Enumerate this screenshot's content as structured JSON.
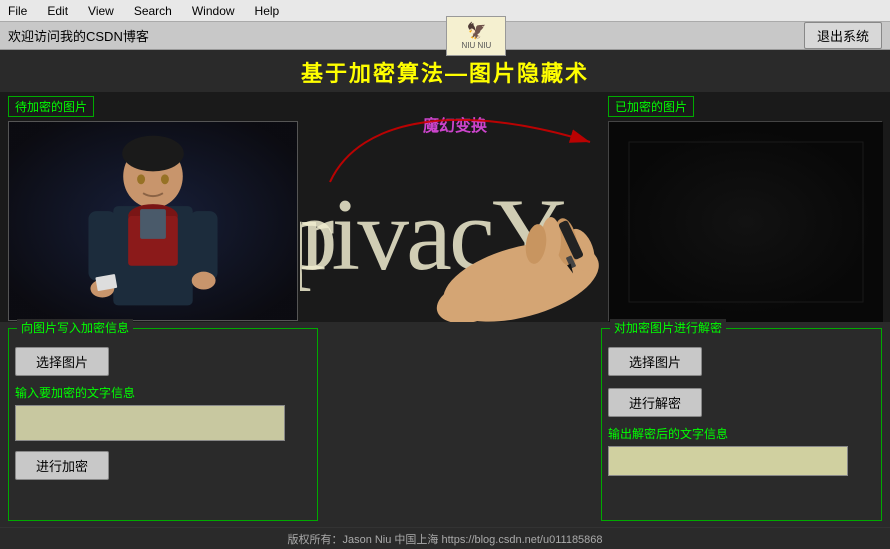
{
  "menubar": {
    "items": [
      "File",
      "Edit",
      "View",
      "Search",
      "Window",
      "Help"
    ]
  },
  "titlebar": {
    "welcome": "欢迎访问我的CSDN博客",
    "logo_text": "NIU NIU",
    "logout_label": "退出系统"
  },
  "main_title": "基于加密算法—图片隐藏术",
  "left_panel": {
    "label": "待加密的图片"
  },
  "center": {
    "magic_label": "魔幻变换",
    "privacy_text": "rivacY"
  },
  "right_panel": {
    "label": "已加密的图片"
  },
  "encrypt_section": {
    "title": "向图片写入加密信息",
    "select_btn": "选择图片",
    "input_label": "输入要加密的文字信息",
    "encrypt_btn": "进行加密"
  },
  "decrypt_section": {
    "title": "对加密图片进行解密",
    "select_btn": "选择图片",
    "decrypt_btn": "进行解密",
    "output_label": "输出解密后的文字信息"
  },
  "footer": {
    "text": "版权所有：Jason Niu  中国上海  https://blog.csdn.net/u011185868"
  }
}
